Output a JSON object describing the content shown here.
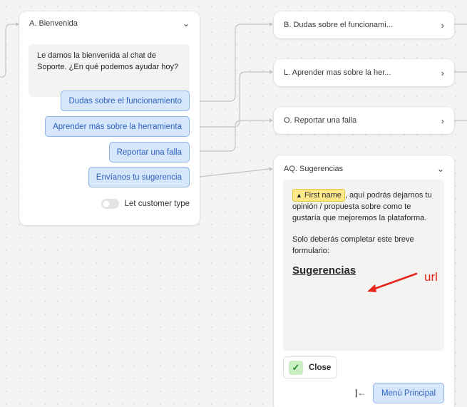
{
  "card_a": {
    "title": "A. Bienvenida",
    "message": "Le damos la bienvenida al chat de Soporte. ¿En qué podemos ayudar hoy?",
    "options": [
      {
        "label": "Dudas sobre el funcionamiento"
      },
      {
        "label": "Aprender más sobre la herramienta"
      },
      {
        "label": "Reportar una falla"
      },
      {
        "label": "Envíanos tu sugerencia"
      }
    ],
    "toggle_label": "Let customer type",
    "toggle_on": false
  },
  "card_b": {
    "title": "B. Dudas sobre el funcionami..."
  },
  "card_l": {
    "title": "L. Aprender mas sobre la her..."
  },
  "card_o": {
    "title": "O. Reportar una falla"
  },
  "card_aq": {
    "title": "AQ. Sugerencias",
    "variable_chip": "First name",
    "message_part1": ", aquí podrás dejarnos tu opinión / propuesta sobre como te gustaría que mejoremos la plataforma.",
    "message_part2": "Solo deberás completar este breve formulario:",
    "link_text": "Sugerencias",
    "annotation": "url",
    "close_label": "Close",
    "menu_label": "Menú Principal"
  },
  "icons": {
    "collapse": "chevron-down-icon",
    "open": "chevron-right-icon",
    "warning": "warning-icon",
    "check": "check-icon",
    "back": "back-to-start-icon"
  },
  "colors": {
    "option_bg": "#d6e6fb",
    "option_border": "#8fb4ea",
    "option_text": "#2f63c0",
    "annotation": "#e8251a",
    "chip_bg": "#fde98a",
    "check_bg": "#c9efc2"
  }
}
